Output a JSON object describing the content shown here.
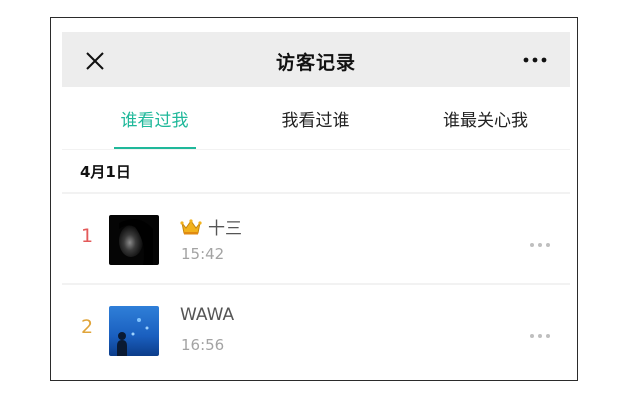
{
  "header": {
    "title": "访客记录"
  },
  "tabs": [
    {
      "label": "谁看过我",
      "active": true
    },
    {
      "label": "我看过谁",
      "active": false
    },
    {
      "label": "谁最关心我",
      "active": false
    }
  ],
  "date_group": {
    "label": "4月1日"
  },
  "visitors": [
    {
      "rank": "1",
      "name": "十三",
      "time": "15:42",
      "badge_icon": "crown-icon",
      "rank_color": "#e35a5a"
    },
    {
      "rank": "2",
      "name": "WAWA",
      "time": "16:56",
      "rank_color": "#e0a43a"
    }
  ],
  "colors": {
    "accent": "#1fb89a",
    "navbar_bg": "#ededed",
    "page_bg": "#f2f2f2"
  }
}
